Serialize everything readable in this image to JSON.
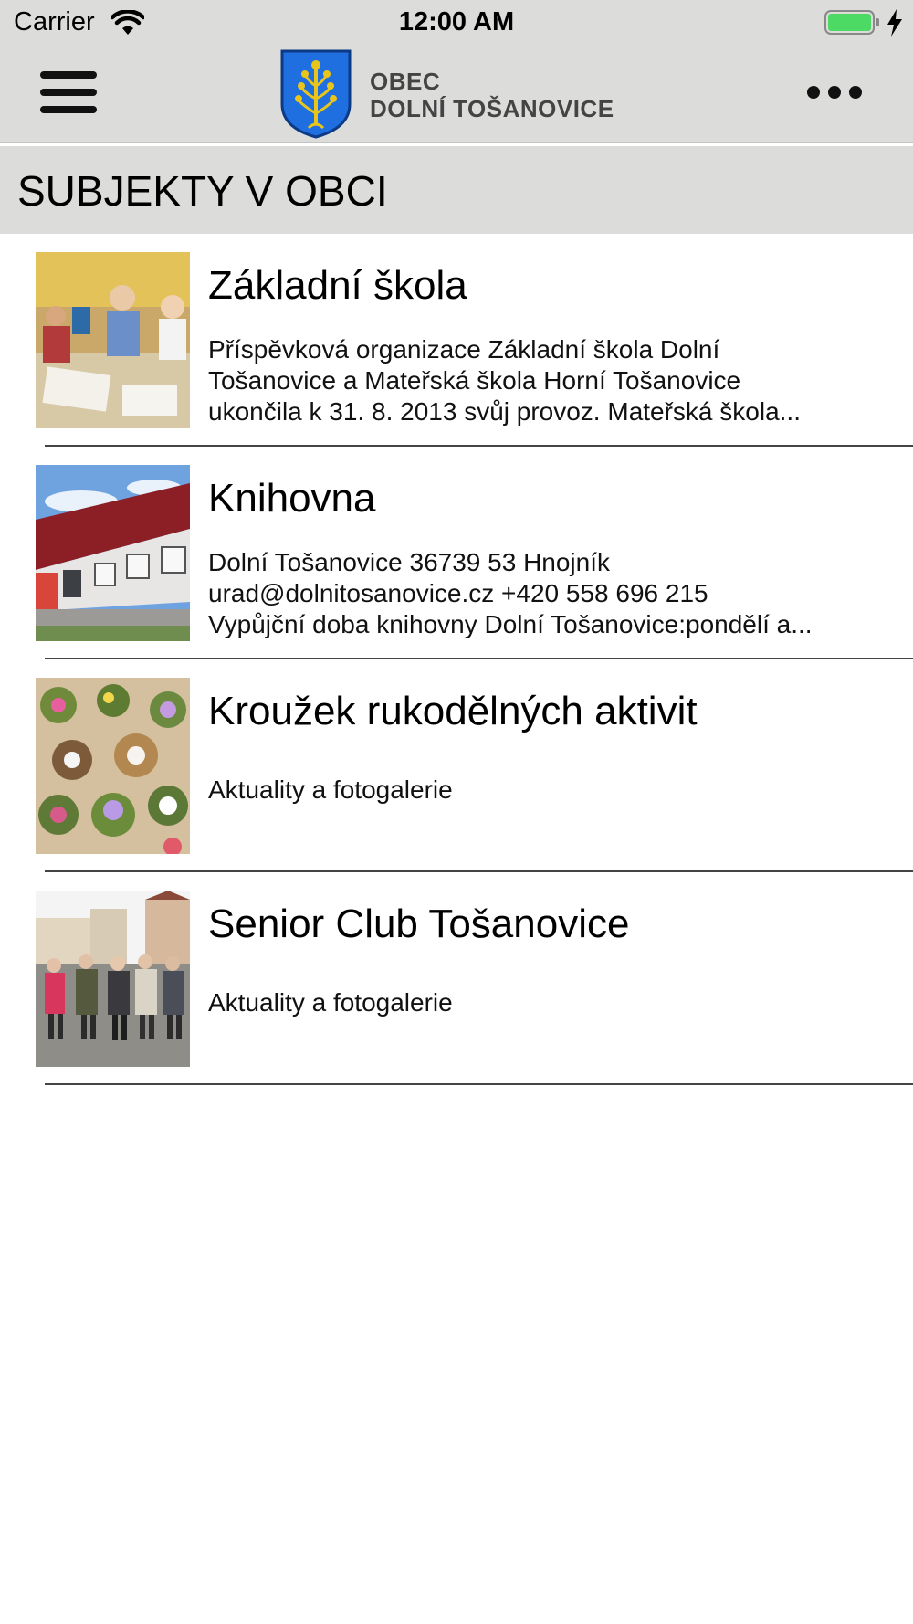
{
  "status_bar": {
    "carrier": "Carrier",
    "time": "12:00 AM",
    "battery_color": "#4cd964"
  },
  "nav": {
    "logo_line1": "OBEC",
    "logo_line2": "DOLNÍ TOŠANOVICE",
    "shield_color": "#1f6fe0",
    "tree_color": "#e9c51b"
  },
  "section": {
    "title": "SUBJEKTY V OBCI"
  },
  "items": [
    {
      "title": "Základní škola",
      "description_lines": [
        "Příspěvková organizace Základní škola Dolní",
        "Tošanovice a Mateřská škola Horní Tošanovice",
        "ukončila k 31. 8. 2013 svůj provoz.  Mateřská škola..."
      ],
      "image": "classroom-photo"
    },
    {
      "title": "Knihovna",
      "description_lines": [
        "Dolní Tošanovice 36739 53 Hnojník",
        "urad@dolnitosanovice.cz  +420 558 696 215",
        "Vypůjční doba knihovny Dolní Tošanovice:pondělí a..."
      ],
      "image": "library-building-photo"
    },
    {
      "title": "Kroužek rukodělných aktivit",
      "description_lines": [
        "Aktuality a fotogalerie"
      ],
      "image": "flower-arrangements-photo"
    },
    {
      "title": "Senior Club Tošanovice",
      "description_lines": [
        "Aktuality a fotogalerie"
      ],
      "image": "seniors-group-photo"
    }
  ]
}
